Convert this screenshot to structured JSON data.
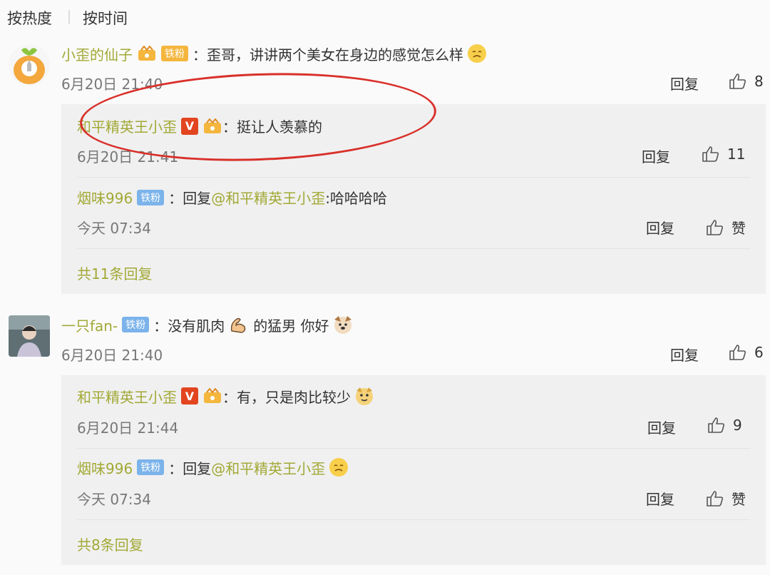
{
  "sort_tabs": [
    {
      "label": "按热度"
    },
    {
      "label": "按时间"
    }
  ],
  "comments": [
    {
      "user": "小歪的仙子",
      "badge": "铁粉",
      "text": "歪哥，讲讲两个美女在身边的感觉怎么样",
      "time": "6月20日 21:40",
      "reply_label": "回复",
      "likes": "8",
      "replies": [
        {
          "user": "和平精英王小歪",
          "text": "挺让人羡慕的",
          "time": "6月20日 21:41",
          "reply_label": "回复",
          "likes": "11"
        },
        {
          "user": "烟味996",
          "badge": "铁粉",
          "text_prefix": "回复",
          "mention": "@和平精英王小歪",
          "text": ":哈哈哈哈",
          "time": "今天 07:34",
          "reply_label": "回复",
          "likes": "赞"
        }
      ],
      "more": "共11条回复"
    },
    {
      "user": "一只fan-",
      "badge": "铁粉",
      "text": "没有肌肉",
      "text2": "的猛男 你好",
      "time": "6月20日 21:40",
      "reply_label": "回复",
      "likes": "6",
      "replies": [
        {
          "user": "和平精英王小歪",
          "text": "有，只是肉比较少",
          "time": "6月20日 21:44",
          "reply_label": "回复",
          "likes": "9"
        },
        {
          "user": "烟味996",
          "badge": "铁粉",
          "text_prefix": "回复",
          "mention": "@和平精英王小歪",
          "text": "",
          "time": "今天 07:34",
          "reply_label": "回复",
          "likes": "赞"
        }
      ],
      "more": "共8条回复"
    }
  ],
  "colors": {
    "username": "#a2a935",
    "badge_blue": "#7bb3ea",
    "badge_gold": "#f4b63d",
    "verified_red": "#e2451f",
    "highlight_circle": "#d9302a"
  },
  "icons": [
    "thumbs-up-icon",
    "verified-v-icon",
    "crown-icon",
    "emoji-icon"
  ]
}
